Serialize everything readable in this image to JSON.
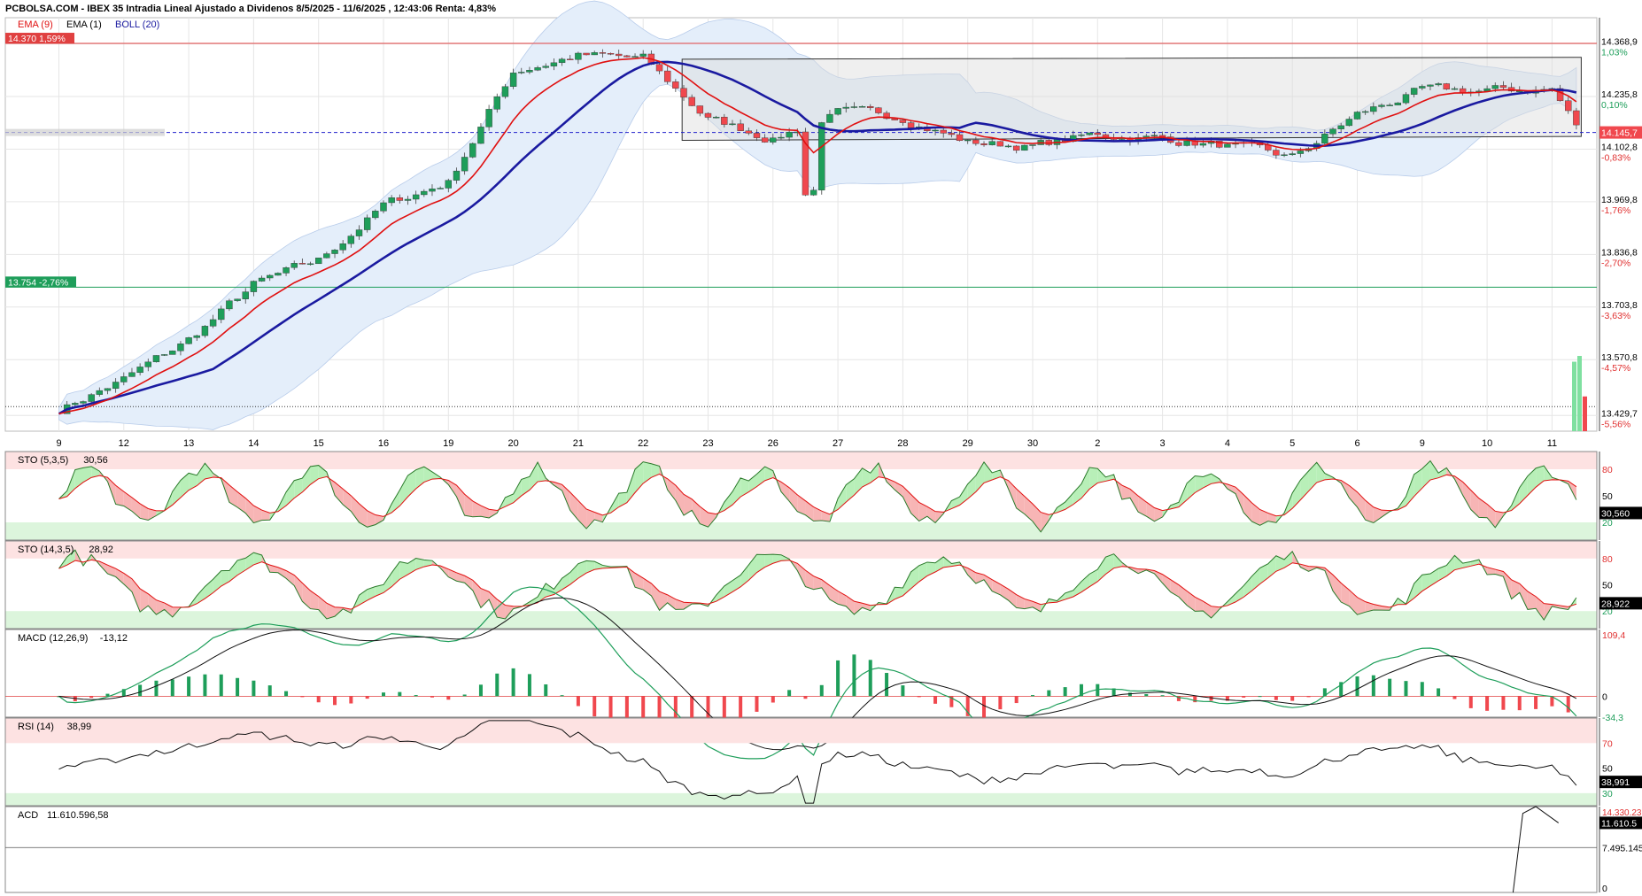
{
  "header": {
    "title": "PCBOLSA.COM - IBEX 35 Intradia Lineal Ajustado a Dividenos 8/5/2025 - 11/6/2025 , 12:43:06 Renta: 4,83%"
  },
  "colors": {
    "up": "#1e9e5a",
    "down": "#f0484e",
    "ema9": "#e01010",
    "boll_mid": "#1a1aa0",
    "band_fill": "#e4eefa",
    "overbought": "#fde2e2",
    "oversold": "#dcf5dc"
  },
  "chart_data": [
    {
      "type": "candlestick",
      "name": "main",
      "legend": [
        "EMA (9)",
        "EMA (1)",
        "BOLL (20)"
      ],
      "x_labels": [
        "9",
        "12",
        "13",
        "14",
        "15",
        "16",
        "19",
        "20",
        "21",
        "22",
        "23",
        "26",
        "27",
        "28",
        "29",
        "30",
        "2",
        "3",
        "4",
        "5",
        "6",
        "9",
        "10",
        "11"
      ],
      "y_ticks": [
        "14.368,9",
        "14.235,8",
        "14.102,8",
        "13.969,8",
        "13.836,8",
        "13.703,8",
        "13.570,8",
        "13.429,7"
      ],
      "y_tick_values": [
        14368.9,
        14235.8,
        14102.8,
        13969.8,
        13836.8,
        13703.8,
        13570.8,
        13429.7
      ],
      "pct_ticks": [
        "1,03%",
        "0,10%",
        "-0,83%",
        "-1,76%",
        "-2,70%",
        "-3,63%",
        "-4,57%",
        "-5,56%"
      ],
      "ylim": [
        13390,
        14435
      ],
      "close_anchor_days": [
        0,
        1,
        2,
        3,
        4,
        5,
        6,
        7,
        8,
        9,
        10,
        11,
        12,
        13,
        14,
        15,
        16,
        17,
        18,
        19,
        20,
        21,
        22,
        23,
        23.45
      ],
      "close_anchor_values": [
        13445,
        13520,
        13620,
        13760,
        13820,
        13960,
        14020,
        14300,
        14340,
        14330,
        14180,
        14130,
        14195,
        14185,
        14120,
        14110,
        14140,
        14130,
        14110,
        14080,
        14190,
        14250,
        14250,
        14255,
        14145
      ],
      "lines": {
        "upper_price": {
          "value": 14370,
          "label": "14.370  1,59%"
        },
        "lower_price": {
          "value": 13754,
          "label": "13.754  -2,76%"
        },
        "current": {
          "value": 14145,
          "label": "14.145,7"
        },
        "reference": {
          "value": 13452
        }
      },
      "channel": {
        "upper": [
          [
            9.6,
            14330
          ],
          [
            23.45,
            14335
          ]
        ],
        "lower": [
          [
            9.6,
            14125
          ],
          [
            23.45,
            14135
          ]
        ]
      },
      "volume_bars": [
        0.6,
        0.65,
        0.3
      ]
    },
    {
      "type": "line",
      "name": "STO (5,3,5)",
      "label": "STO (5,3,5)",
      "value_label": "30,56",
      "last": "30,560",
      "y_ticks": [
        "80",
        "50",
        "20"
      ],
      "ylim": [
        0,
        100
      ]
    },
    {
      "type": "line",
      "name": "STO (14,3,5)",
      "label": "STO (14,3,5)",
      "value_label": "28,92",
      "last": "28,922",
      "y_ticks": [
        "80",
        "50",
        "20"
      ],
      "ylim": [
        0,
        100
      ]
    },
    {
      "type": "bar",
      "name": "MACD (12,26,9)",
      "label": "MACD (12,26,9)",
      "value_label": "-13,12",
      "y_ticks": [
        "109,4",
        "0",
        "-34,3"
      ],
      "ylim": [
        -34.3,
        109.4
      ]
    },
    {
      "type": "line",
      "name": "RSI (14)",
      "label": "RSI (14)",
      "value_label": "38,99",
      "last": "38,991",
      "y_ticks": [
        "70",
        "50",
        "30"
      ],
      "ylim": [
        20,
        90
      ]
    },
    {
      "type": "line",
      "name": "ACD",
      "label": "ACD",
      "value_label": "11.610.596,58",
      "last": "11.610.5",
      "y_ticks": [
        "14.330.23",
        "7.495.145",
        "0"
      ],
      "ylim": [
        0,
        14330230
      ]
    }
  ]
}
